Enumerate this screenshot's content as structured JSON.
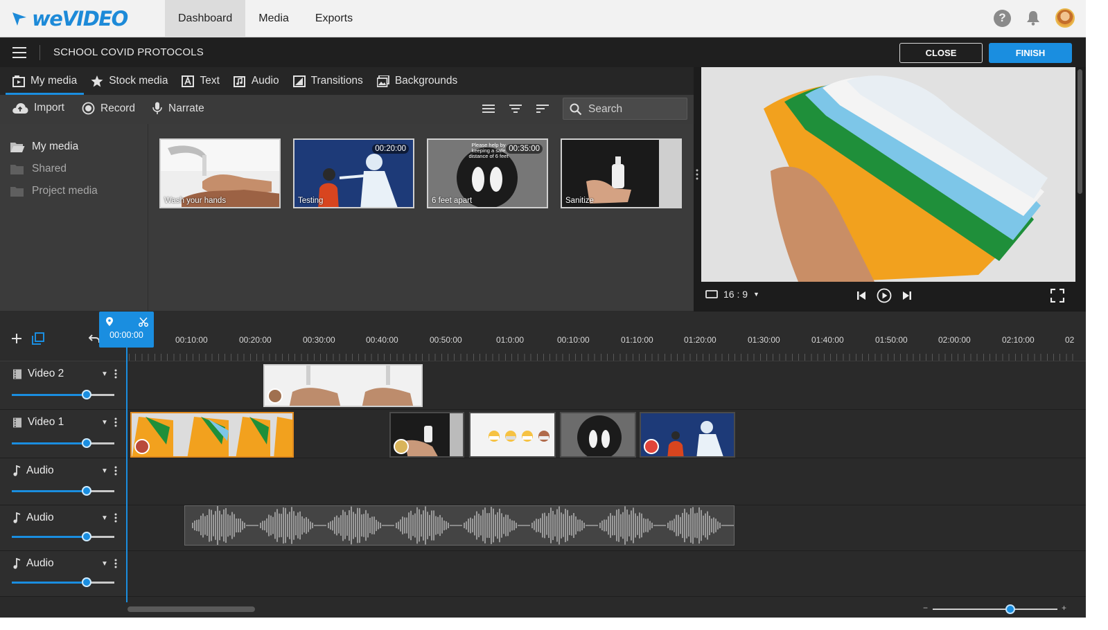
{
  "app": {
    "brand": "weVIDEO",
    "accent": "#1a8ee0",
    "clip_selected_color": "#e08a1e"
  },
  "topnav": {
    "tabs": [
      {
        "label": "Dashboard",
        "active": true
      },
      {
        "label": "Media",
        "active": false
      },
      {
        "label": "Exports",
        "active": false
      }
    ],
    "icons": [
      "help-icon",
      "bell-icon",
      "user-avatar"
    ]
  },
  "project": {
    "title": "SCHOOL COVID PROTOCOLS",
    "close_label": "CLOSE",
    "finish_label": "FINISH"
  },
  "media_tabs": [
    {
      "label": "My media",
      "icon": "my-media-icon",
      "active": true
    },
    {
      "label": "Stock media",
      "icon": "star-icon",
      "active": false
    },
    {
      "label": "Text",
      "icon": "text-icon",
      "active": false
    },
    {
      "label": "Audio",
      "icon": "music-note-icon",
      "active": false
    },
    {
      "label": "Transitions",
      "icon": "transitions-icon",
      "active": false
    },
    {
      "label": "Backgrounds",
      "icon": "backgrounds-icon",
      "active": false
    }
  ],
  "toolbar": {
    "import_label": "Import",
    "record_label": "Record",
    "narrate_label": "Narrate",
    "search_placeholder": "Search"
  },
  "folders": [
    {
      "label": "My media",
      "active": true
    },
    {
      "label": "Shared",
      "active": false
    },
    {
      "label": "Project media",
      "active": false
    }
  ],
  "media_items": [
    {
      "caption": "Wash your hands",
      "duration": ""
    },
    {
      "caption": "Testing",
      "duration": "00:20:00"
    },
    {
      "caption": "6 feet apart",
      "duration": "00:35:00",
      "overlay_text": "Please help by keeping a safe distance of 6 feet"
    },
    {
      "caption": "Sanitize",
      "duration": ""
    }
  ],
  "preview": {
    "aspect_ratio": "16 : 9",
    "controls": [
      "skip-back-icon",
      "play-icon",
      "skip-forward-icon",
      "fullscreen-icon"
    ]
  },
  "timeline": {
    "playhead_time": "00:00:00",
    "ticks": [
      "00:10:00",
      "00:20:00",
      "00:30:00",
      "00:40:00",
      "00:50:00",
      "01:0:00",
      "00:10:00",
      "01:10:00",
      "01:20:00",
      "01:30:00",
      "01:40:00",
      "01:50:00",
      "02:00:00",
      "02:10:00",
      "02"
    ],
    "tracks": [
      {
        "name": "Video 2",
        "type": "video",
        "volume": 0.73
      },
      {
        "name": "Video 1",
        "type": "video",
        "volume": 0.73
      },
      {
        "name": "Audio",
        "type": "audio",
        "volume": 0.73
      },
      {
        "name": "Audio",
        "type": "audio",
        "volume": 0.73
      },
      {
        "name": "Audio",
        "type": "audio",
        "volume": 0.73
      }
    ],
    "zoom_level": 0.62
  }
}
